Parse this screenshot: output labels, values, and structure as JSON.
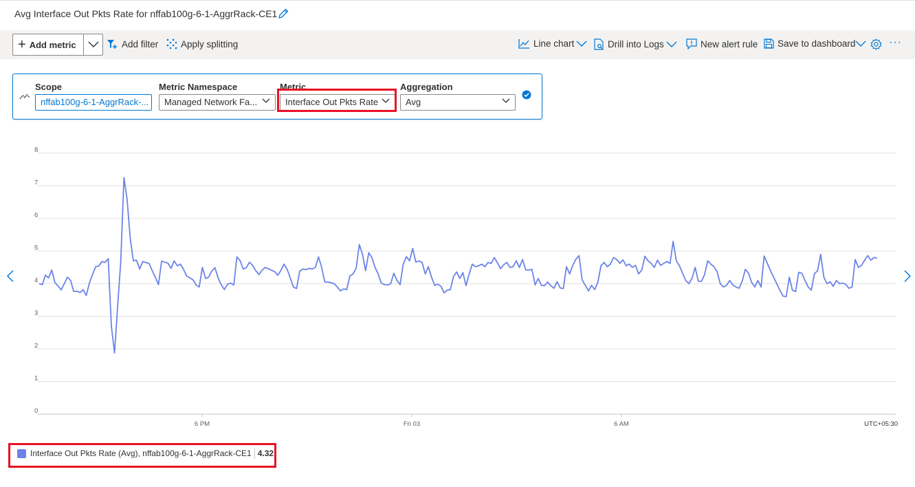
{
  "header": {
    "title": "Avg Interface Out Pkts Rate for nffab100g-6-1-AggrRack-CE1",
    "edit_icon": "pencil-icon"
  },
  "toolbar": {
    "add_metric": "Add metric",
    "add_filter": "Add filter",
    "apply_splitting": "Apply splitting",
    "line_chart": "Line chart",
    "drill_into_logs": "Drill into Logs",
    "new_alert_rule": "New alert rule",
    "save_to_dashboard": "Save to dashboard",
    "settings_icon": "gear-icon",
    "more": "···"
  },
  "metric_row": {
    "scope_label": "Scope",
    "scope_value": "nffab100g-6-1-AggrRack-...",
    "namespace_label": "Metric Namespace",
    "namespace_value": "Managed Network Fa...",
    "metric_label": "Metric",
    "metric_value": "Interface Out Pkts Rate",
    "aggregation_label": "Aggregation",
    "aggregation_value": "Avg"
  },
  "accent_color": "#0078d4",
  "highlight_color": "#e81123",
  "legend": {
    "series_label": "Interface Out Pkts Rate (Avg), nffab100g-6-1-AggrRack-CE1",
    "value": "4.32"
  },
  "chart_data": {
    "type": "line",
    "y_ticks": [
      "8",
      "7",
      "6",
      "5",
      "4",
      "3",
      "2",
      "1",
      "0"
    ],
    "x_ticks": [
      "6 PM",
      "Fri 03",
      "6 AM"
    ],
    "timezone": "UTC+05:30",
    "ylim": [
      0,
      8
    ],
    "grid": true,
    "series": [
      {
        "color": "#6b83e8",
        "values": [
          4.0,
          3.97,
          4.26,
          4.18,
          4.42,
          4.04,
          3.93,
          3.81,
          4.0,
          4.2,
          4.1,
          3.76,
          3.77,
          3.73,
          3.82,
          3.64,
          4.02,
          4.28,
          4.52,
          4.54,
          4.68,
          4.65,
          4.77,
          2.7,
          1.88,
          3.3,
          4.7,
          7.25,
          6.6,
          5.4,
          4.7,
          4.72,
          4.45,
          4.68,
          4.65,
          4.62,
          4.4,
          4.2,
          3.97,
          4.69,
          4.66,
          4.63,
          4.47,
          4.7,
          4.55,
          4.6,
          4.44,
          4.23,
          4.18,
          4.12,
          3.96,
          3.9,
          4.5,
          4.16,
          4.2,
          4.39,
          4.49,
          4.18,
          3.97,
          3.82,
          3.98,
          4.02,
          3.96,
          4.82,
          4.71,
          4.45,
          4.49,
          4.66,
          4.56,
          4.4,
          4.28,
          4.41,
          4.5,
          4.46,
          4.41,
          4.37,
          4.26,
          4.4,
          4.6,
          4.44,
          4.18,
          3.9,
          3.85,
          4.38,
          4.45,
          4.43,
          4.47,
          4.45,
          4.5,
          4.82,
          4.5,
          4.05,
          4.05,
          4.03,
          4.0,
          3.9,
          3.78,
          3.84,
          3.82,
          4.24,
          4.3,
          4.48,
          5.2,
          4.9,
          4.4,
          4.95,
          4.8,
          4.5,
          4.3,
          4.02,
          3.97,
          3.96,
          4.0,
          4.32,
          4.1,
          3.97,
          4.6,
          4.83,
          4.7,
          5.08,
          4.66,
          4.7,
          4.65,
          4.3,
          4.52,
          4.2,
          3.95,
          3.98,
          3.92,
          3.72,
          3.8,
          3.82,
          4.22,
          4.36,
          4.16,
          4.34,
          3.94,
          4.3,
          4.6,
          4.52,
          4.55,
          4.6,
          4.52,
          4.65,
          4.62,
          4.8,
          4.64,
          4.46,
          4.58,
          4.65,
          4.5,
          4.52,
          4.7,
          4.5,
          4.74,
          4.42,
          4.42,
          4.44,
          3.96,
          4.16,
          3.95,
          3.94,
          4.05,
          3.94,
          3.86,
          4.06,
          3.87,
          3.85,
          4.52,
          4.3,
          4.56,
          4.75,
          4.86,
          4.12,
          3.95,
          3.78,
          3.95,
          3.82,
          4.05,
          4.55,
          4.65,
          4.52,
          4.6,
          4.8,
          4.74,
          4.62,
          4.73,
          4.55,
          4.6,
          4.5,
          4.56,
          4.3,
          4.42,
          4.84,
          4.7,
          4.62,
          4.5,
          4.72,
          4.56,
          4.62,
          4.68,
          4.62,
          5.3,
          4.7,
          4.55,
          4.32,
          4.1,
          4.0,
          4.16,
          4.5,
          4.08,
          4.07,
          4.28,
          4.7,
          4.6,
          4.52,
          4.36,
          4.0,
          3.9,
          3.95,
          4.1,
          3.96,
          3.9,
          3.86,
          4.08,
          4.44,
          4.32,
          4.04,
          3.9,
          4.1,
          3.9,
          4.85,
          4.62,
          4.4,
          4.2,
          4.0,
          3.8,
          3.62,
          3.6,
          4.2,
          3.8,
          3.76,
          4.35,
          4.32,
          4.1,
          3.9,
          3.8,
          4.3,
          4.4,
          4.9,
          4.2,
          4.0,
          4.06,
          3.92,
          4.1,
          4.0,
          4.02,
          3.98,
          3.86,
          3.9,
          4.74,
          4.5,
          4.56,
          4.72,
          4.86,
          4.72,
          4.8,
          4.78
        ]
      }
    ]
  }
}
